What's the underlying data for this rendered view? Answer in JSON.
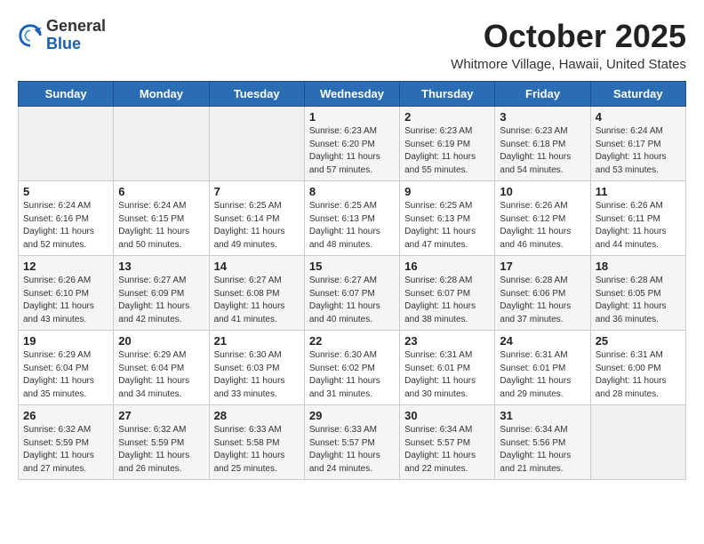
{
  "header": {
    "logo_general": "General",
    "logo_blue": "Blue",
    "month_title": "October 2025",
    "location": "Whitmore Village, Hawaii, United States"
  },
  "weekdays": [
    "Sunday",
    "Monday",
    "Tuesday",
    "Wednesday",
    "Thursday",
    "Friday",
    "Saturday"
  ],
  "weeks": [
    [
      {
        "day": "",
        "sunrise": "",
        "sunset": "",
        "daylight": ""
      },
      {
        "day": "",
        "sunrise": "",
        "sunset": "",
        "daylight": ""
      },
      {
        "day": "",
        "sunrise": "",
        "sunset": "",
        "daylight": ""
      },
      {
        "day": "1",
        "sunrise": "Sunrise: 6:23 AM",
        "sunset": "Sunset: 6:20 PM",
        "daylight": "Daylight: 11 hours and 57 minutes."
      },
      {
        "day": "2",
        "sunrise": "Sunrise: 6:23 AM",
        "sunset": "Sunset: 6:19 PM",
        "daylight": "Daylight: 11 hours and 55 minutes."
      },
      {
        "day": "3",
        "sunrise": "Sunrise: 6:23 AM",
        "sunset": "Sunset: 6:18 PM",
        "daylight": "Daylight: 11 hours and 54 minutes."
      },
      {
        "day": "4",
        "sunrise": "Sunrise: 6:24 AM",
        "sunset": "Sunset: 6:17 PM",
        "daylight": "Daylight: 11 hours and 53 minutes."
      }
    ],
    [
      {
        "day": "5",
        "sunrise": "Sunrise: 6:24 AM",
        "sunset": "Sunset: 6:16 PM",
        "daylight": "Daylight: 11 hours and 52 minutes."
      },
      {
        "day": "6",
        "sunrise": "Sunrise: 6:24 AM",
        "sunset": "Sunset: 6:15 PM",
        "daylight": "Daylight: 11 hours and 50 minutes."
      },
      {
        "day": "7",
        "sunrise": "Sunrise: 6:25 AM",
        "sunset": "Sunset: 6:14 PM",
        "daylight": "Daylight: 11 hours and 49 minutes."
      },
      {
        "day": "8",
        "sunrise": "Sunrise: 6:25 AM",
        "sunset": "Sunset: 6:13 PM",
        "daylight": "Daylight: 11 hours and 48 minutes."
      },
      {
        "day": "9",
        "sunrise": "Sunrise: 6:25 AM",
        "sunset": "Sunset: 6:13 PM",
        "daylight": "Daylight: 11 hours and 47 minutes."
      },
      {
        "day": "10",
        "sunrise": "Sunrise: 6:26 AM",
        "sunset": "Sunset: 6:12 PM",
        "daylight": "Daylight: 11 hours and 46 minutes."
      },
      {
        "day": "11",
        "sunrise": "Sunrise: 6:26 AM",
        "sunset": "Sunset: 6:11 PM",
        "daylight": "Daylight: 11 hours and 44 minutes."
      }
    ],
    [
      {
        "day": "12",
        "sunrise": "Sunrise: 6:26 AM",
        "sunset": "Sunset: 6:10 PM",
        "daylight": "Daylight: 11 hours and 43 minutes."
      },
      {
        "day": "13",
        "sunrise": "Sunrise: 6:27 AM",
        "sunset": "Sunset: 6:09 PM",
        "daylight": "Daylight: 11 hours and 42 minutes."
      },
      {
        "day": "14",
        "sunrise": "Sunrise: 6:27 AM",
        "sunset": "Sunset: 6:08 PM",
        "daylight": "Daylight: 11 hours and 41 minutes."
      },
      {
        "day": "15",
        "sunrise": "Sunrise: 6:27 AM",
        "sunset": "Sunset: 6:07 PM",
        "daylight": "Daylight: 11 hours and 40 minutes."
      },
      {
        "day": "16",
        "sunrise": "Sunrise: 6:28 AM",
        "sunset": "Sunset: 6:07 PM",
        "daylight": "Daylight: 11 hours and 38 minutes."
      },
      {
        "day": "17",
        "sunrise": "Sunrise: 6:28 AM",
        "sunset": "Sunset: 6:06 PM",
        "daylight": "Daylight: 11 hours and 37 minutes."
      },
      {
        "day": "18",
        "sunrise": "Sunrise: 6:28 AM",
        "sunset": "Sunset: 6:05 PM",
        "daylight": "Daylight: 11 hours and 36 minutes."
      }
    ],
    [
      {
        "day": "19",
        "sunrise": "Sunrise: 6:29 AM",
        "sunset": "Sunset: 6:04 PM",
        "daylight": "Daylight: 11 hours and 35 minutes."
      },
      {
        "day": "20",
        "sunrise": "Sunrise: 6:29 AM",
        "sunset": "Sunset: 6:04 PM",
        "daylight": "Daylight: 11 hours and 34 minutes."
      },
      {
        "day": "21",
        "sunrise": "Sunrise: 6:30 AM",
        "sunset": "Sunset: 6:03 PM",
        "daylight": "Daylight: 11 hours and 33 minutes."
      },
      {
        "day": "22",
        "sunrise": "Sunrise: 6:30 AM",
        "sunset": "Sunset: 6:02 PM",
        "daylight": "Daylight: 11 hours and 31 minutes."
      },
      {
        "day": "23",
        "sunrise": "Sunrise: 6:31 AM",
        "sunset": "Sunset: 6:01 PM",
        "daylight": "Daylight: 11 hours and 30 minutes."
      },
      {
        "day": "24",
        "sunrise": "Sunrise: 6:31 AM",
        "sunset": "Sunset: 6:01 PM",
        "daylight": "Daylight: 11 hours and 29 minutes."
      },
      {
        "day": "25",
        "sunrise": "Sunrise: 6:31 AM",
        "sunset": "Sunset: 6:00 PM",
        "daylight": "Daylight: 11 hours and 28 minutes."
      }
    ],
    [
      {
        "day": "26",
        "sunrise": "Sunrise: 6:32 AM",
        "sunset": "Sunset: 5:59 PM",
        "daylight": "Daylight: 11 hours and 27 minutes."
      },
      {
        "day": "27",
        "sunrise": "Sunrise: 6:32 AM",
        "sunset": "Sunset: 5:59 PM",
        "daylight": "Daylight: 11 hours and 26 minutes."
      },
      {
        "day": "28",
        "sunrise": "Sunrise: 6:33 AM",
        "sunset": "Sunset: 5:58 PM",
        "daylight": "Daylight: 11 hours and 25 minutes."
      },
      {
        "day": "29",
        "sunrise": "Sunrise: 6:33 AM",
        "sunset": "Sunset: 5:57 PM",
        "daylight": "Daylight: 11 hours and 24 minutes."
      },
      {
        "day": "30",
        "sunrise": "Sunrise: 6:34 AM",
        "sunset": "Sunset: 5:57 PM",
        "daylight": "Daylight: 11 hours and 22 minutes."
      },
      {
        "day": "31",
        "sunrise": "Sunrise: 6:34 AM",
        "sunset": "Sunset: 5:56 PM",
        "daylight": "Daylight: 11 hours and 21 minutes."
      },
      {
        "day": "",
        "sunrise": "",
        "sunset": "",
        "daylight": ""
      }
    ]
  ]
}
